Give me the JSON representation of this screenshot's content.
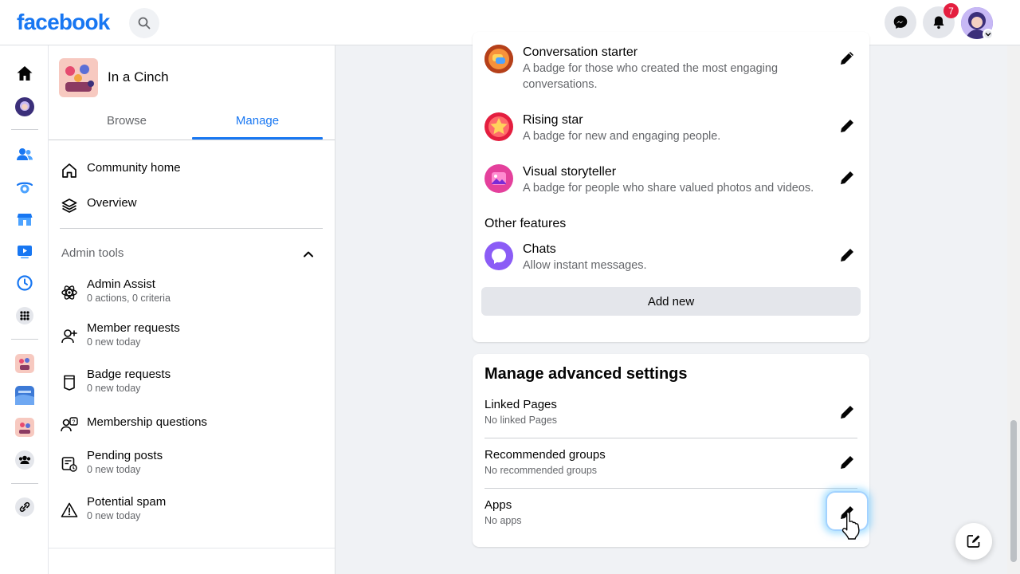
{
  "header": {
    "logo": "facebook",
    "notification_count": "7"
  },
  "group": {
    "name": "In a Cinch"
  },
  "tabs": [
    {
      "label": "Browse"
    },
    {
      "label": "Manage"
    }
  ],
  "sidebar": {
    "nav": [
      {
        "label": "Community home"
      },
      {
        "label": "Overview"
      }
    ],
    "admin_tools_title": "Admin tools",
    "admin_items": [
      {
        "label": "Admin Assist",
        "sub": "0 actions, 0 criteria"
      },
      {
        "label": "Member requests",
        "sub": "0 new today"
      },
      {
        "label": "Badge requests",
        "sub": "0 new today"
      },
      {
        "label": "Membership questions",
        "sub": ""
      },
      {
        "label": "Pending posts",
        "sub": "0 new today"
      },
      {
        "label": "Potential spam",
        "sub": "0 new today"
      }
    ]
  },
  "badges": [
    {
      "title": "Conversation starter",
      "desc": "A badge for those who created the most engaging conversations."
    },
    {
      "title": "Rising star",
      "desc": "A badge for new and engaging people."
    },
    {
      "title": "Visual storyteller",
      "desc": "A badge for people who share valued photos and videos."
    }
  ],
  "other_features": {
    "heading": "Other features",
    "items": [
      {
        "title": "Chats",
        "desc": "Allow instant messages."
      }
    ]
  },
  "add_new_label": "Add new",
  "advanced": {
    "title": "Manage advanced settings",
    "rows": [
      {
        "label": "Linked Pages",
        "sub": "No linked Pages"
      },
      {
        "label": "Recommended groups",
        "sub": "No recommended groups"
      },
      {
        "label": "Apps",
        "sub": "No apps"
      }
    ]
  },
  "colors": {
    "brand": "#1877f2",
    "secondary_text": "#65676b",
    "badge_orange": "#f7923b",
    "badge_red": "#e41e3f",
    "badge_pink": "#e4409c",
    "chat_purple": "#8b5cf6"
  }
}
